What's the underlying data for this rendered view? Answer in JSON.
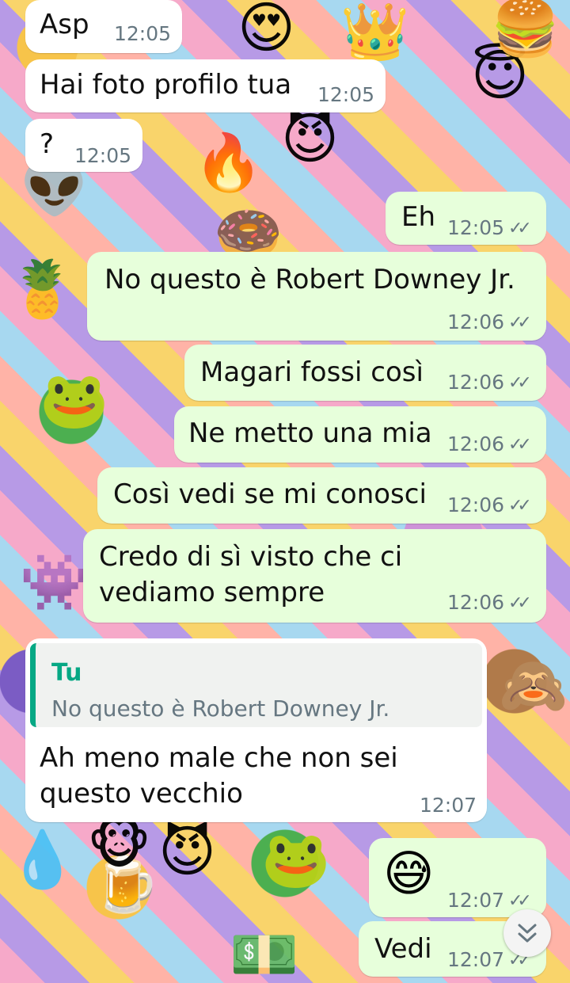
{
  "colors": {
    "incoming": "#ffffff",
    "outgoing": "#e7ffdb",
    "accent": "#06a884",
    "meta": "#667781"
  },
  "wallpaper": {
    "icons": [
      "😍",
      "👑",
      "😇",
      "😈",
      "🔥",
      "👽",
      "🐸",
      "🍍",
      "🙈",
      "🍺",
      "💧",
      "👾",
      "🍩",
      "🍔",
      "🐵",
      "💵"
    ]
  },
  "messages": [
    {
      "side": "in",
      "text": "Asp",
      "time": "12:05"
    },
    {
      "side": "in",
      "text": "Hai foto profilo tua",
      "time": "12:05"
    },
    {
      "side": "in",
      "text": "?",
      "time": "12:05"
    },
    {
      "side": "out",
      "text": "Eh",
      "time": "12:05",
      "ticks": "✓✓"
    },
    {
      "side": "out",
      "text": "No questo è Robert Downey Jr.",
      "time": "12:06",
      "ticks": "✓✓"
    },
    {
      "side": "out",
      "text": "Magari fossi così",
      "time": "12:06",
      "ticks": "✓✓"
    },
    {
      "side": "out",
      "text": "Ne metto una mia",
      "time": "12:06",
      "ticks": "✓✓"
    },
    {
      "side": "out",
      "text": "Così vedi se mi conosci",
      "time": "12:06",
      "ticks": "✓✓"
    },
    {
      "side": "out",
      "lines": [
        "Credo di sì visto che ci",
        "vediamo sempre"
      ],
      "time": "12:06",
      "ticks": "✓✓"
    },
    {
      "side": "in",
      "quote": {
        "author": "Tu",
        "text": "No questo è Robert Downey Jr."
      },
      "lines": [
        "Ah meno male che non sei",
        "questo vecchio"
      ],
      "time": "12:07"
    },
    {
      "side": "out",
      "emoji": "😅",
      "time": "12:07",
      "ticks": "✓✓"
    },
    {
      "side": "out",
      "text": "Vedi",
      "time": "12:07",
      "ticks": "✓✓"
    }
  ],
  "scroll_button": {
    "icon": "double-chevron-down-icon",
    "glyph": "⌄"
  }
}
